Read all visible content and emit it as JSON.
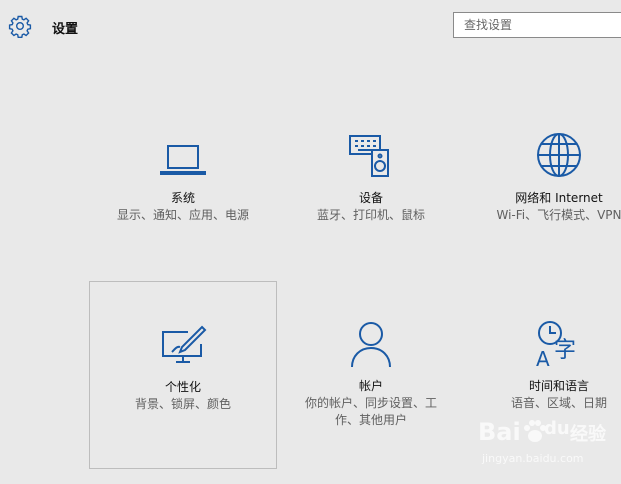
{
  "header": {
    "title": "设置",
    "search_placeholder": "查找设置",
    "icon": "gear-icon"
  },
  "tiles": [
    {
      "name": "系统",
      "desc": "显示、通知、应用、电源",
      "icon": "laptop-icon"
    },
    {
      "name": "设备",
      "desc": "蓝牙、打印机、鼠标",
      "icon": "devices-icon"
    },
    {
      "name": "网络和 Internet",
      "desc": "Wi-Fi、飞行模式、VPN",
      "icon": "globe-icon"
    },
    {
      "name": "个性化",
      "desc": "背景、锁屏、颜色",
      "icon": "personalization-icon",
      "selected": true
    },
    {
      "name": "帐户",
      "desc": "你的帐户、同步设置、工作、其他用户",
      "icon": "person-icon"
    },
    {
      "name": "时间和语言",
      "desc": "语音、区域、日期",
      "icon": "time-language-icon"
    }
  ],
  "watermark": {
    "brand": "Bai",
    "brand2": "du",
    "label": "经验",
    "url": "jingyan.baidu.com"
  },
  "colors": {
    "accent": "#1a5aa6",
    "background": "#e9e9e9"
  }
}
